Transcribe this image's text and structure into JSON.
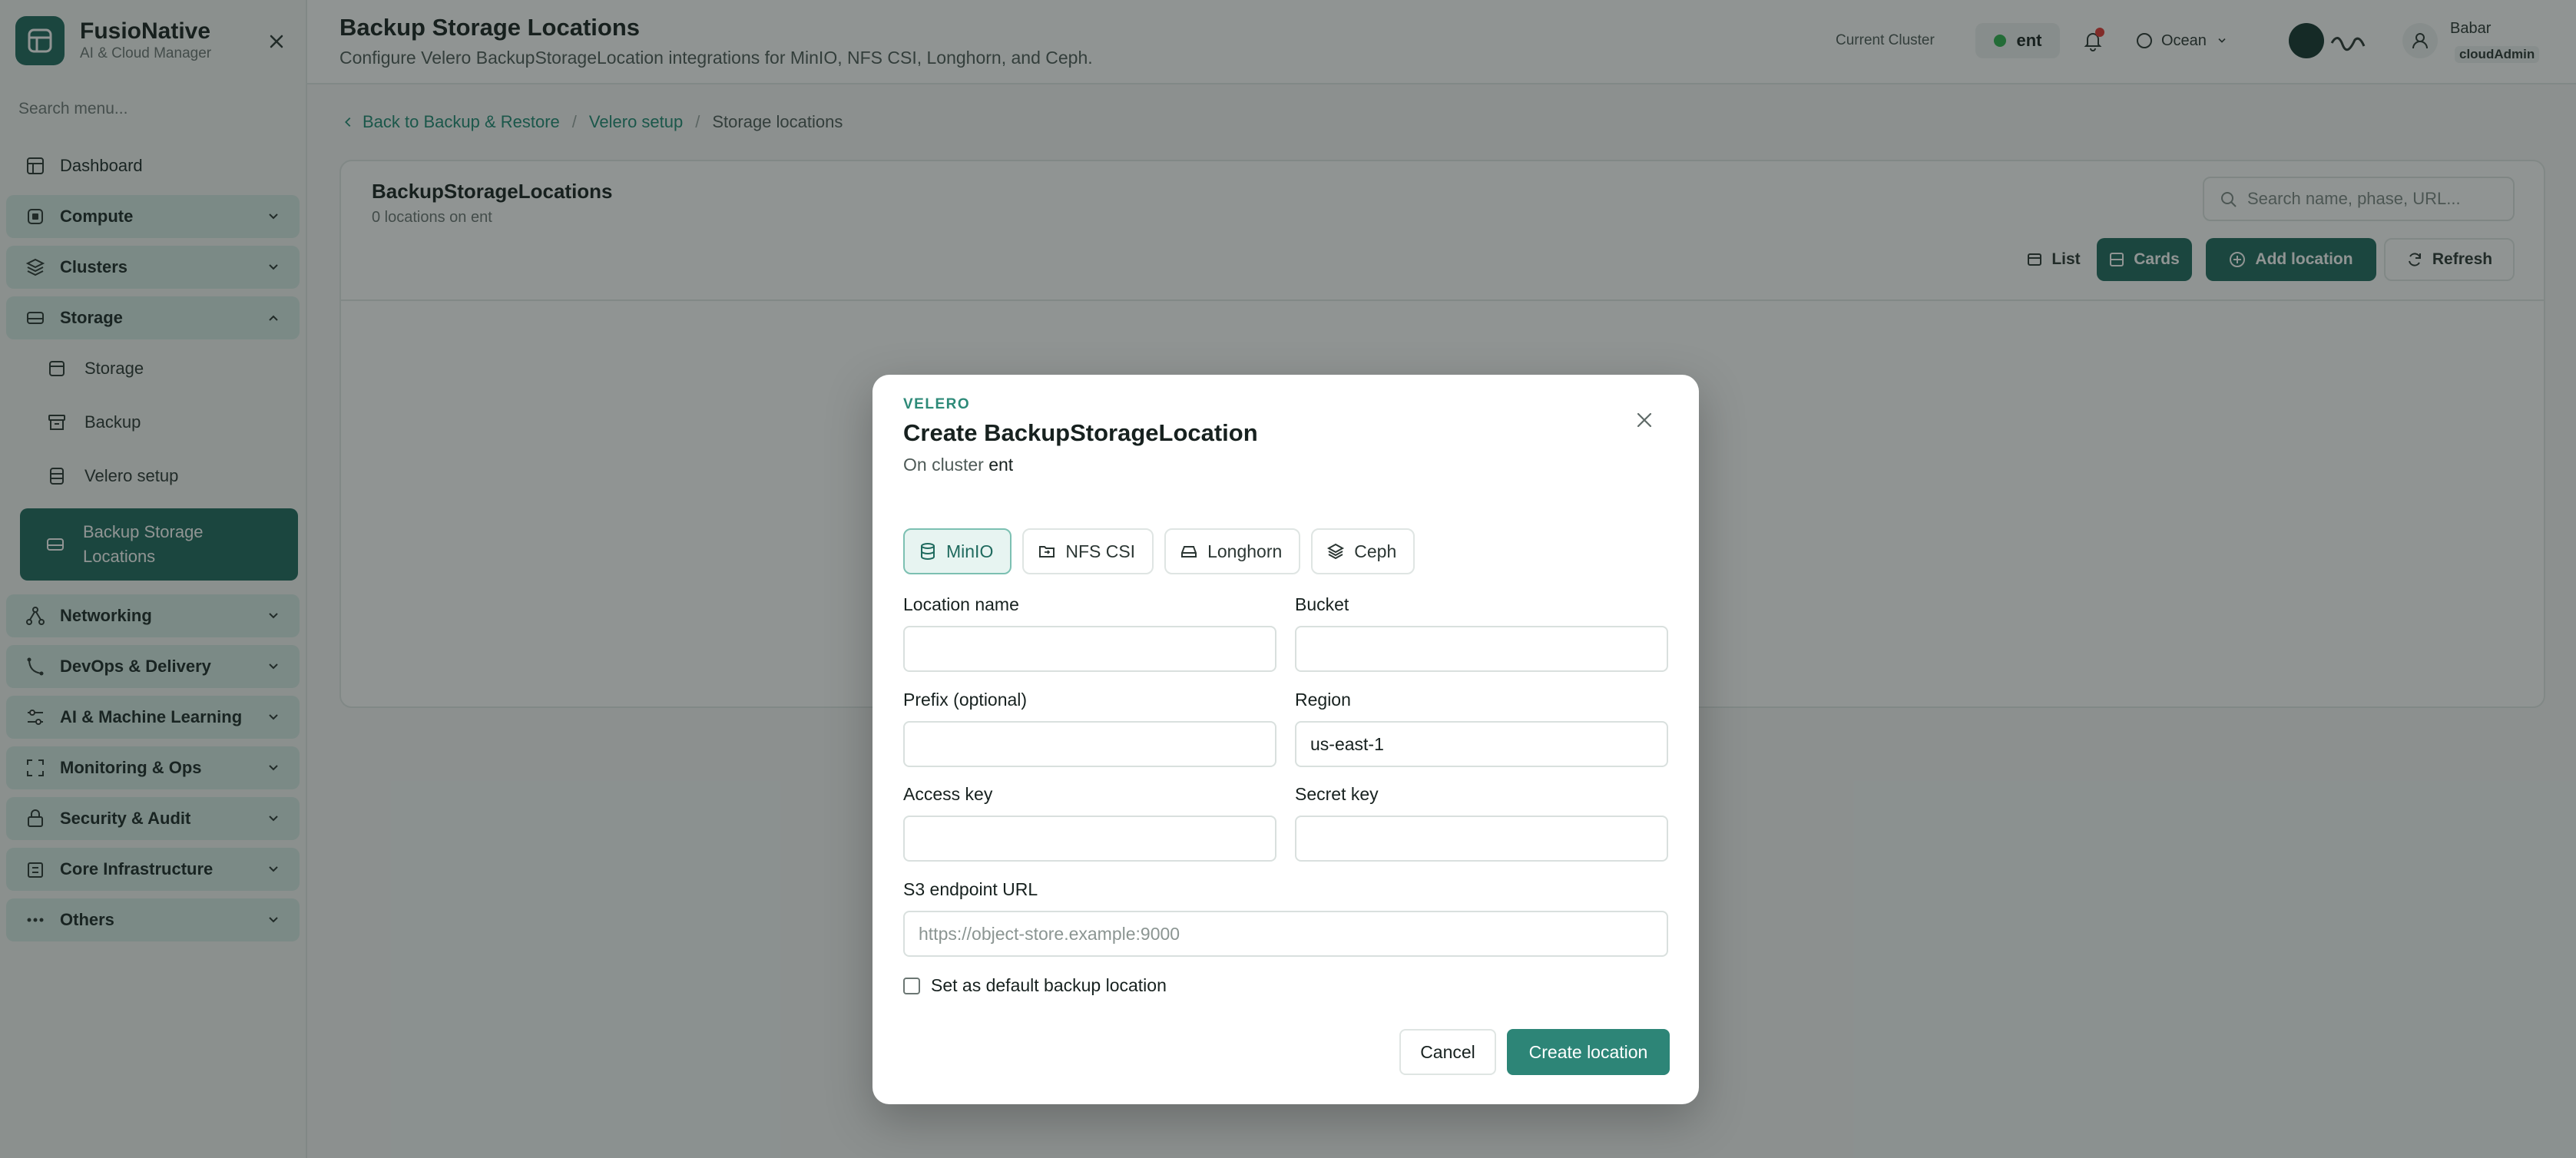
{
  "brand": {
    "name": "FusioNative",
    "subtitle": "AI & Cloud Manager"
  },
  "sidebar": {
    "search_placeholder": "Search menu...",
    "dashboard": "Dashboard",
    "groups_top": [
      "Compute",
      "Clusters"
    ],
    "storage": {
      "label": "Storage",
      "items": [
        "Storage",
        "Backup",
        "Velero setup"
      ],
      "active_item": "Backup Storage Locations"
    },
    "groups_bottom": [
      "Networking",
      "DevOps & Delivery",
      "AI & Machine Learning",
      "Monitoring & Ops",
      "Security & Audit",
      "Core Infrastructure",
      "Others"
    ]
  },
  "header": {
    "title": "Backup Storage Locations",
    "subtitle": "Configure Velero BackupStorageLocation integrations for MinIO, NFS CSI, Longhorn, and Ceph.",
    "cluster_label": "Current Cluster",
    "cluster_name": "ent",
    "theme": "Ocean",
    "user_name": "Babar",
    "user_role": "cloudAdmin"
  },
  "breadcrumb": {
    "link1": "Back to Backup & Restore",
    "link2": "Velero setup",
    "current": "Storage locations"
  },
  "panel": {
    "title": "BackupStorageLocations",
    "subtitle": "0 locations on ent",
    "search_placeholder": "Search name, phase, URL...",
    "list_label": "List",
    "cards_label": "Cards",
    "add_label": "Add location",
    "refresh_label": "Refresh"
  },
  "modal": {
    "kicker": "VELERO",
    "title": "Create BackupStorageLocation",
    "subtitle_prefix": "On cluster",
    "cluster": "ent",
    "tabs": [
      "MinIO",
      "NFS CSI",
      "Longhorn",
      "Ceph"
    ],
    "active_tab": "MinIO",
    "fields": {
      "location_name": {
        "label": "Location name",
        "value": ""
      },
      "bucket": {
        "label": "Bucket",
        "value": ""
      },
      "prefix": {
        "label": "Prefix (optional)",
        "value": ""
      },
      "region": {
        "label": "Region",
        "value": "us-east-1"
      },
      "access_key": {
        "label": "Access key",
        "value": ""
      },
      "secret_key": {
        "label": "Secret key",
        "value": ""
      },
      "s3_url": {
        "label": "S3 endpoint URL",
        "value": "",
        "placeholder": "https://object-store.example:9000"
      }
    },
    "default_checkbox": "Set as default backup location",
    "cancel_label": "Cancel",
    "create_label": "Create location"
  },
  "colors": {
    "accent": "#1f6a5e",
    "primary_button": "#2d8577",
    "status_online": "#2eb24f",
    "notification": "#e53935"
  }
}
